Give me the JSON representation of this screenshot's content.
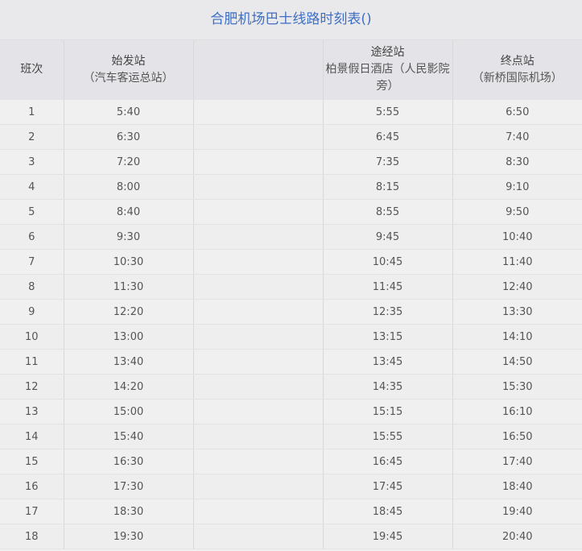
{
  "title": "合肥机场巴士线路时刻表()",
  "headers": {
    "trip": "班次",
    "origin": "始发站",
    "origin_sub": "（汽车客运总站）",
    "via": "途经站",
    "via_sub": "柏景假日酒店（人民影院旁）",
    "terminal": "终点站",
    "terminal_sub": "（新桥国际机场）"
  },
  "rows": [
    {
      "no": "1",
      "depart": "5:40",
      "via": "5:55",
      "arrive": "6:50"
    },
    {
      "no": "2",
      "depart": "6:30",
      "via": "6:45",
      "arrive": "7:40"
    },
    {
      "no": "3",
      "depart": "7:20",
      "via": "7:35",
      "arrive": "8:30"
    },
    {
      "no": "4",
      "depart": "8:00",
      "via": "8:15",
      "arrive": "9:10"
    },
    {
      "no": "5",
      "depart": "8:40",
      "via": "8:55",
      "arrive": "9:50"
    },
    {
      "no": "6",
      "depart": "9:30",
      "via": "9:45",
      "arrive": "10:40"
    },
    {
      "no": "7",
      "depart": "10:30",
      "via": "10:45",
      "arrive": "11:40"
    },
    {
      "no": "8",
      "depart": "11:30",
      "via": "11:45",
      "arrive": "12:40"
    },
    {
      "no": "9",
      "depart": "12:20",
      "via": "12:35",
      "arrive": "13:30"
    },
    {
      "no": "10",
      "depart": "13:00",
      "via": "13:15",
      "arrive": "14:10"
    },
    {
      "no": "11",
      "depart": "13:40",
      "via": "13:45",
      "arrive": "14:50"
    },
    {
      "no": "12",
      "depart": "14:20",
      "via": "14:35",
      "arrive": "15:30"
    },
    {
      "no": "13",
      "depart": "15:00",
      "via": "15:15",
      "arrive": "16:10"
    },
    {
      "no": "14",
      "depart": "15:40",
      "via": "15:55",
      "arrive": "16:50"
    },
    {
      "no": "15",
      "depart": "16:30",
      "via": "16:45",
      "arrive": "17:40"
    },
    {
      "no": "16",
      "depart": "17:30",
      "via": "17:45",
      "arrive": "18:40"
    },
    {
      "no": "17",
      "depart": "18:30",
      "via": "18:45",
      "arrive": "19:40"
    },
    {
      "no": "18",
      "depart": "19:30",
      "via": "19:45",
      "arrive": "20:40"
    }
  ]
}
